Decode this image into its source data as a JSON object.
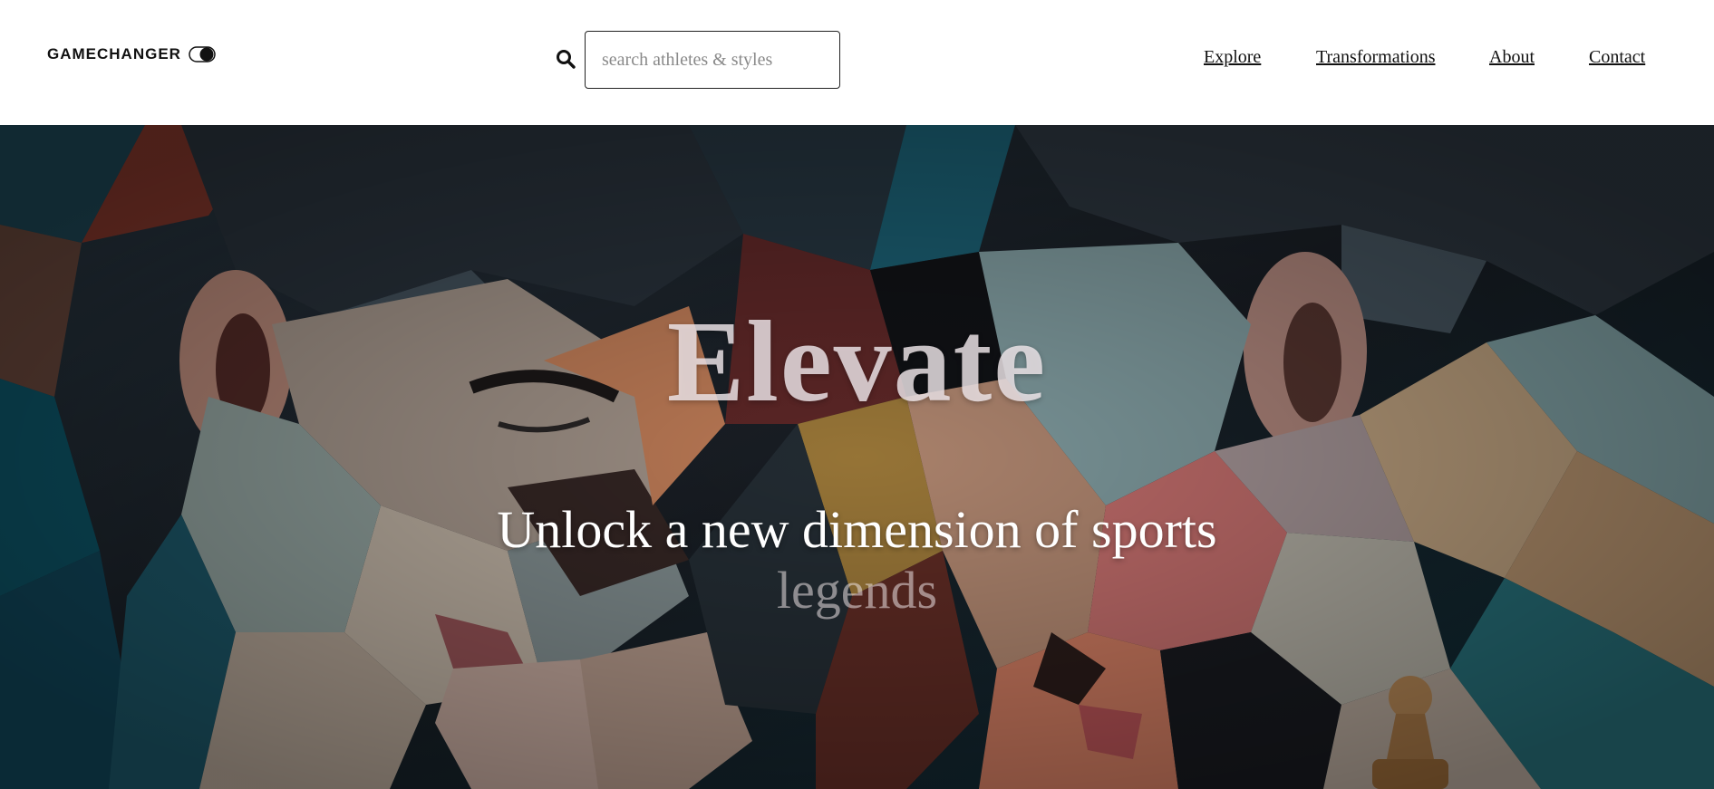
{
  "header": {
    "logo_text": "GAMECHANGER",
    "search": {
      "placeholder": "search athletes & styles",
      "value": ""
    },
    "nav": [
      {
        "label": "Explore"
      },
      {
        "label": "Transformations"
      },
      {
        "label": "About"
      },
      {
        "label": "Contact"
      }
    ]
  },
  "hero": {
    "title": "Elevate",
    "subtitle_line1": "Unlock a new dimension of sports",
    "subtitle_line2": "legends",
    "image_description_icon": "cubist-chess-players-image"
  },
  "colors": {
    "header_bg": "#ffffff",
    "text": "#111111",
    "hero_title": "#f0e8ec",
    "hero_subtitle": "#ffffff"
  }
}
